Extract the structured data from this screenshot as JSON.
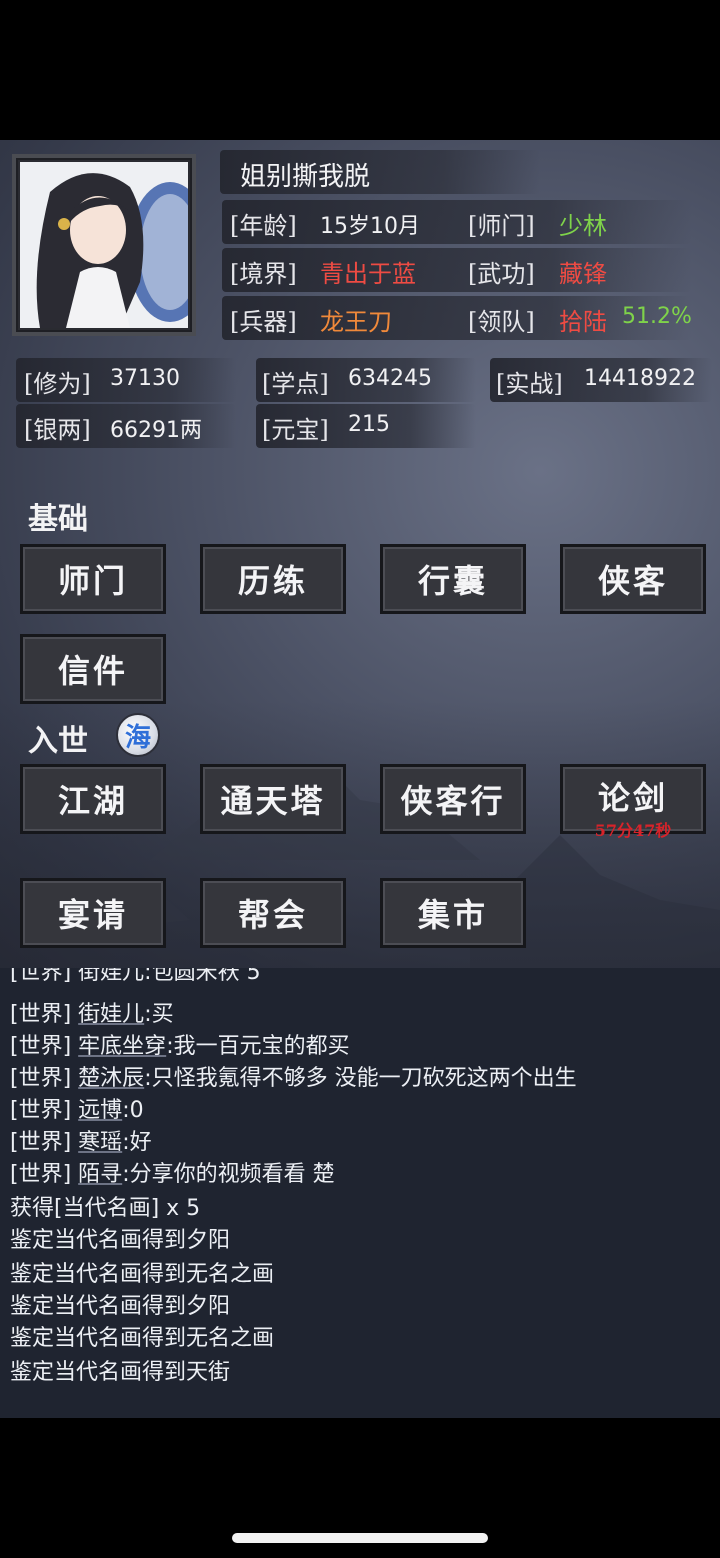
{
  "colors": {
    "green": "#7fd34a",
    "red": "#ee4b43",
    "orange": "#f0893a",
    "timer_red": "#d8232a",
    "sea_blue": "#2f6fd8"
  },
  "profile": {
    "name": "姐别撕我脱",
    "age_label": "[年龄]",
    "age_value": "15岁10月",
    "sect_label": "[师门]",
    "sect_value": "少林",
    "realm_label": "[境界]",
    "realm_value": "青出于蓝",
    "martial_label": "[武功]",
    "martial_value": "藏锋",
    "weapon_label": "[兵器]",
    "weapon_value": "龙王刀",
    "team_label": "[领队]",
    "team_value": "拾陆",
    "team_percent": "51.2%"
  },
  "stats": {
    "cultivation_label": "[修为]",
    "cultivation_value": "37130",
    "study_label": "[学点]",
    "study_value": "634245",
    "combat_label": "[实战]",
    "combat_value": "14418922",
    "silver_label": "[银两]",
    "silver_value": "66291两",
    "ingot_label": "[元宝]",
    "ingot_value": "215"
  },
  "basic": {
    "title": "基础",
    "buttons": [
      "师门",
      "历练",
      "行囊",
      "侠客",
      "信件"
    ]
  },
  "world": {
    "title": "入世",
    "badge": "海",
    "buttons": [
      "江湖",
      "通天塔",
      "侠客行",
      "论剑",
      "宴请",
      "帮会",
      "集市"
    ],
    "lunjian_timer": "57分47秒"
  },
  "chat": {
    "partial_line": "[世界] 街娃儿:包圆米袄 5",
    "lines": [
      {
        "channel": "[世界]",
        "name": "街娃儿",
        "text": ":买"
      },
      {
        "channel": "[世界]",
        "name": "牢底坐穿",
        "text": ":我一百元宝的都买"
      },
      {
        "channel": "[世界]",
        "name": "楚沐辰",
        "text": ":只怪我氪得不够多 没能一刀砍死这两个出生"
      },
      {
        "channel": "[世界]",
        "name": "远博",
        "text": ":0"
      },
      {
        "channel": "[世界]",
        "name": "寒瑶",
        "text": ":好"
      },
      {
        "channel": "[世界]",
        "name": "陌寻",
        "text": ":分享你的视频看看   楚"
      }
    ],
    "system_lines": [
      "获得[当代名画] x 5",
      "鉴定当代名画得到夕阳",
      "鉴定当代名画得到无名之画",
      "鉴定当代名画得到夕阳",
      "鉴定当代名画得到无名之画",
      "鉴定当代名画得到天街"
    ]
  }
}
